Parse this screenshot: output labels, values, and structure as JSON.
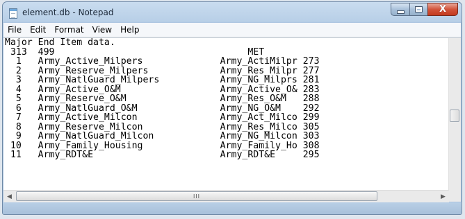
{
  "window": {
    "title": "element.db - Notepad",
    "icon": "notepad-icon",
    "caption_buttons": [
      "minimize-icon",
      "maximize-icon",
      "close-icon"
    ],
    "close_glyph": "X"
  },
  "menu": [
    "File",
    "Edit",
    "Format",
    "View",
    "Help"
  ],
  "document": {
    "lines": [
      "Major End Item data.",
      " 313  499                                   MET",
      "  1   Army_Active_Milpers              Army_ActiMilpr 273",
      "  2   Army_Reserve_Milpers             Army_Res_Milpr 277",
      "  3   Army_NatlGuard_Milpers           Army_NG_Milprs 281",
      "  4   Army_Active_O&M                  Army_Active_O& 283",
      "  5   Army_Reserve_O&M                 Army_Res_O&M   288",
      "  6   Army_NatlGuard_O&M               Army_NG_O&M    292",
      "  7   Army_Active_Milcon               Army_Act_Milco 299",
      "  8   Army_Reserve_Milcon              Army_Res_Milco 305",
      "  9   Army_NatlGuard_Milcon            Army_NG_Milcon 303",
      " 10   Army_Family_Housing              Army_Family_Ho 308",
      " 11   Army_RDT&E                       Army_RDT&E     295"
    ]
  },
  "scrollbar": {
    "left_arrow": "◀",
    "right_arrow": "▶",
    "grip": "III"
  }
}
